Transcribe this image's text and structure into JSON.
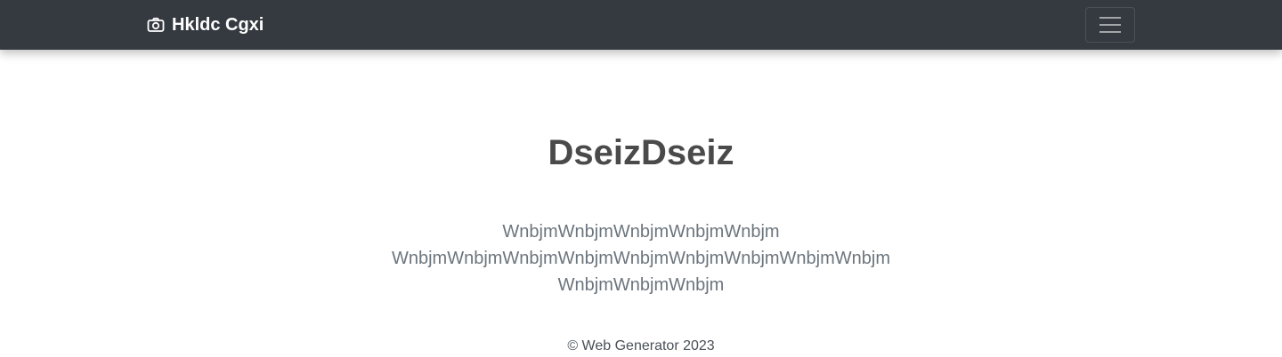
{
  "navbar": {
    "brand_icon": "camera-icon",
    "brand_text": "Hkldc Cgxi",
    "toggler_icon": "hamburger-menu-icon",
    "background": "#343a40"
  },
  "hero": {
    "title": "DseizDseiz",
    "lines": [
      "WnbjmWnbjmWnbjmWnbjmWnbjm",
      "WnbjmWnbjmWnbjmWnbjmWnbjmWnbjmWnbjmWnbjmWnbjm",
      "WnbjmWnbjmWnbjm"
    ]
  },
  "footer": {
    "text": "© Web Generator 2023"
  }
}
